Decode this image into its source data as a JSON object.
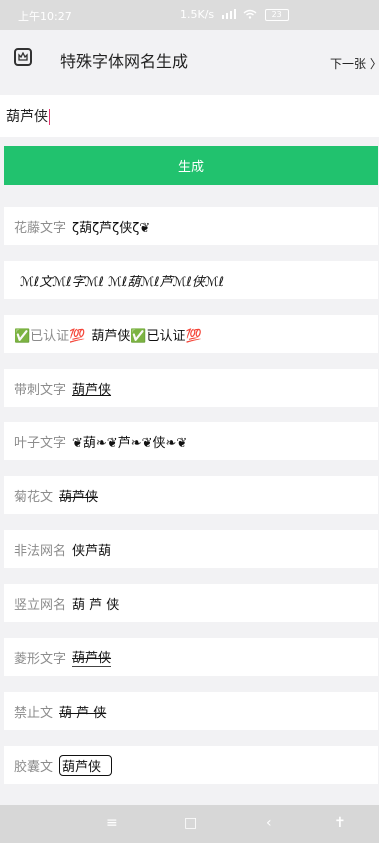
{
  "status": {
    "time": "上午10:27",
    "speed": "1.5K/s",
    "battery": "23"
  },
  "header": {
    "title": "特殊字体网名生成",
    "next_label": "下一张 〉"
  },
  "input": {
    "value": "葫芦侠"
  },
  "generate_label": "生成",
  "rows": [
    {
      "label": "花藤文字",
      "value": "ζ葫ζ芦ζ侠ζ❦"
    },
    {
      "label": "",
      "value": "ℳℓ文ℳℓ字ℳℓ ℳℓ葫ℳℓ芦ℳℓ侠ℳℓ"
    },
    {
      "label": "✅已认证💯",
      "value": "葫芦侠✅已认证💯"
    },
    {
      "label": "带刺文字",
      "value": "葫芦侠"
    },
    {
      "label": "叶子文字",
      "value": "❦葫❧❦芦❧❦侠❧❦"
    },
    {
      "label": "菊花文",
      "value": "葫芦侠"
    },
    {
      "label": "非法网名",
      "value": "侠芦葫"
    },
    {
      "label": "竖立网名",
      "value": "葫 芦 侠"
    },
    {
      "label": "菱形文字",
      "value": "葫芦侠"
    },
    {
      "label": "禁止文",
      "value": "葫 芦 侠"
    },
    {
      "label": "胶囊文",
      "value": "葫芦侠"
    }
  ]
}
